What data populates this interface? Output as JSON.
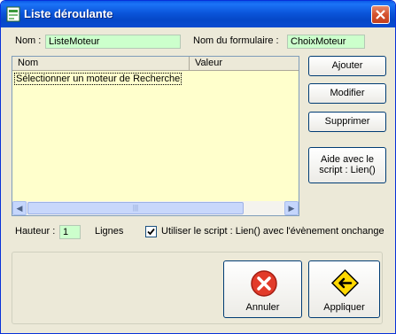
{
  "window": {
    "title": "Liste déroulante",
    "icon": "form-list-icon",
    "close_icon": "close-icon"
  },
  "fields": {
    "nom_label": "Nom :",
    "nom_value": "ListeMoteur",
    "form_label": "Nom du formulaire :",
    "form_value": "ChoixMoteur"
  },
  "list": {
    "columns": [
      "Nom",
      "Valeur"
    ],
    "rows": [
      {
        "nom": "Sélectionner un moteur de Recherche",
        "valeur": ""
      }
    ]
  },
  "buttons": {
    "add": "Ajouter",
    "modify": "Modifier",
    "delete": "Supprimer",
    "help_line1": "Aide avec le",
    "help_line2": "script : Lien()"
  },
  "options": {
    "height_label": "Hauteur :",
    "height_value": "1",
    "lines_label": "Lignes",
    "script_checked": true,
    "script_label": "Utiliser le script : Lien()  avec l'évènement onchange"
  },
  "actions": {
    "cancel": "Annuler",
    "apply": "Appliquer",
    "cancel_icon": "red-x-icon",
    "apply_icon": "yellow-arrow-sign-icon"
  },
  "colors": {
    "field_bg": "#ccffcc",
    "list_bg": "#ffffcc",
    "titlebar": "#0a54dc"
  }
}
